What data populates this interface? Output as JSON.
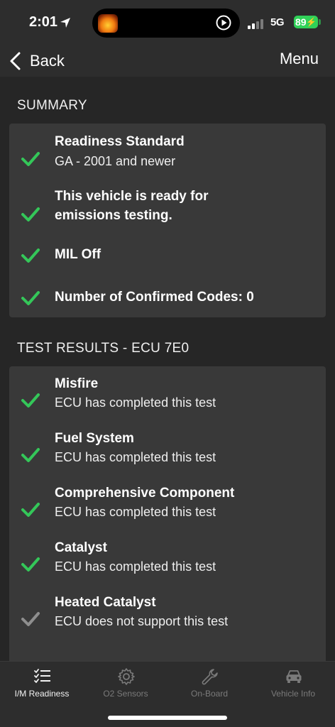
{
  "status_bar": {
    "time": "2:01",
    "network": "5G",
    "battery": "89"
  },
  "nav": {
    "back_label": "Back",
    "menu_label": "Menu"
  },
  "summary": {
    "header": "SUMMARY",
    "items": [
      {
        "title": "Readiness Standard",
        "subtitle": "GA - 2001 and newer",
        "status": "complete"
      },
      {
        "title_line1": "This vehicle is ready for",
        "title_line2": "emissions testing.",
        "status": "complete"
      },
      {
        "title": "MIL Off",
        "status": "complete"
      },
      {
        "title": "Number of Confirmed Codes: 0",
        "status": "complete"
      }
    ]
  },
  "test_results": {
    "header": "TEST RESULTS - ECU 7E0",
    "items": [
      {
        "title": "Misfire",
        "subtitle": "ECU has completed this test",
        "status": "complete"
      },
      {
        "title": "Fuel System",
        "subtitle": "ECU has completed this test",
        "status": "complete"
      },
      {
        "title": "Comprehensive Component",
        "subtitle": "ECU has completed this test",
        "status": "complete"
      },
      {
        "title": "Catalyst",
        "subtitle": "ECU has completed this test",
        "status": "complete"
      },
      {
        "title": "Heated Catalyst",
        "subtitle": "ECU does not support this test",
        "status": "unsupported"
      }
    ]
  },
  "tabs": [
    {
      "label": "I/M Readiness",
      "icon": "checklist-icon",
      "active": true
    },
    {
      "label": "O2 Sensors",
      "icon": "gear-icon",
      "active": false
    },
    {
      "label": "On-Board",
      "icon": "wrench-icon",
      "active": false
    },
    {
      "label": "Vehicle Info",
      "icon": "car-icon",
      "active": false
    }
  ],
  "colors": {
    "check_complete": "#34c759",
    "check_unsupported": "#8e8e8e",
    "background": "#262626",
    "card": "#393939",
    "battery": "#30d158"
  }
}
